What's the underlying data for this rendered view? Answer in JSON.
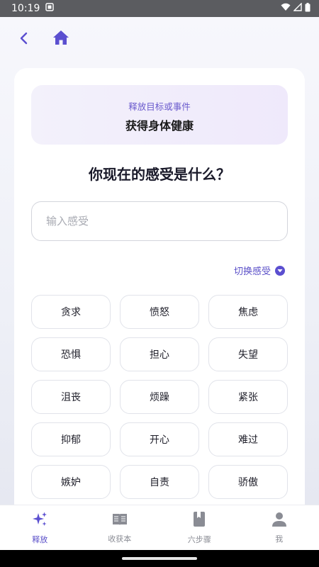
{
  "status_bar": {
    "time": "10:19"
  },
  "colors": {
    "accent": "#5a4fc8",
    "nav_icon": "#5b4fd0",
    "status_bar": "#5b5c60"
  },
  "target": {
    "label": "释放目标或事件",
    "title": "获得身体健康"
  },
  "question": "你现在的感受是什么？",
  "input": {
    "placeholder": "输入感受",
    "value": ""
  },
  "switch_label": "切换感受",
  "feelings": [
    "贪求",
    "愤怒",
    "焦虑",
    "恐惧",
    "担心",
    "失望",
    "沮丧",
    "烦躁",
    "紧张",
    "抑郁",
    "开心",
    "难过",
    "嫉妒",
    "自责",
    "骄傲"
  ],
  "bottom_nav": [
    {
      "label": "释放",
      "icon": "sparkle-icon",
      "active": true
    },
    {
      "label": "收获本",
      "icon": "open-book-icon",
      "active": false
    },
    {
      "label": "六步骤",
      "icon": "bookmark-book-icon",
      "active": false
    },
    {
      "label": "我",
      "icon": "person-icon",
      "active": false
    }
  ]
}
